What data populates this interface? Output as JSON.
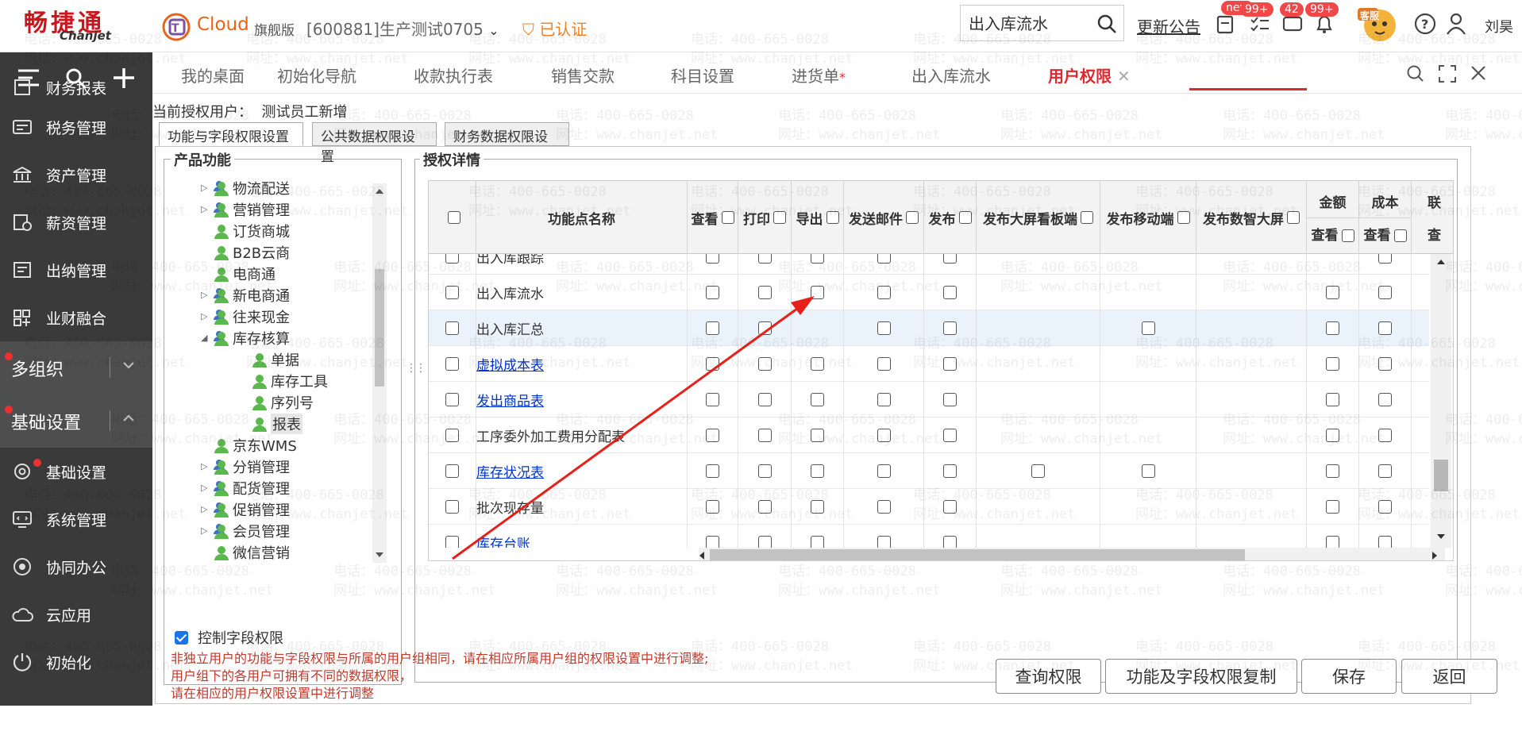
{
  "brand": {
    "logo_cn": "畅捷通",
    "logo_en": "Chanjet",
    "cloud": "Cloud",
    "edition": "旗舰版"
  },
  "header": {
    "company": "[600881]生产测试0705",
    "verified": "已认证",
    "search_value": "出入库流水",
    "notice": "更新公告",
    "badges": [
      "new",
      "99+",
      "42",
      "99+"
    ],
    "service": "客服",
    "username": "刘昊"
  },
  "sidebar": {
    "items_top": [
      {
        "label": "财务报表",
        "icon": "report-icon"
      },
      {
        "label": "税务管理",
        "icon": "tax-icon"
      },
      {
        "label": "资产管理",
        "icon": "bank-icon"
      },
      {
        "label": "薪资管理",
        "icon": "salary-icon"
      },
      {
        "label": "出纳管理",
        "icon": "cashier-icon"
      },
      {
        "label": "业财融合",
        "icon": "grid-icon"
      }
    ],
    "groups": [
      {
        "label": "多组织"
      },
      {
        "label": "基础设置"
      }
    ],
    "items_bottom": [
      {
        "label": "基础设置",
        "icon": "settings-icon"
      },
      {
        "label": "系统管理",
        "icon": "system-icon"
      },
      {
        "label": "协同办公",
        "icon": "collab-icon"
      },
      {
        "label": "云应用",
        "icon": "cloud-icon"
      },
      {
        "label": "初始化",
        "icon": "init-icon"
      }
    ]
  },
  "tabs": [
    {
      "label": "我的桌面"
    },
    {
      "label": "初始化导航"
    },
    {
      "label": "收款执行表"
    },
    {
      "label": "销售交款"
    },
    {
      "label": "科目设置"
    },
    {
      "label": "进货单"
    },
    {
      "label": "出入库流水"
    },
    {
      "label": "用户权限"
    }
  ],
  "tab_star": "*",
  "content": {
    "user_label": "当前授权用户：",
    "user_name": "测试员工新增",
    "subtabs": [
      "功能与字段权限设置",
      "公共数据权限设置",
      "财务数据权限设置"
    ],
    "tree_title": "产品功能",
    "tree": [
      {
        "label": "物流配送",
        "arrow": "▷",
        "indent": 0
      },
      {
        "label": "营销管理",
        "arrow": "▷",
        "indent": 0
      },
      {
        "label": "订货商城",
        "arrow": "",
        "indent": 0
      },
      {
        "label": "B2B云商",
        "arrow": "",
        "indent": 0
      },
      {
        "label": "电商通",
        "arrow": "",
        "indent": 0
      },
      {
        "label": "新电商通",
        "arrow": "▷",
        "indent": 0
      },
      {
        "label": "往来现金",
        "arrow": "▷",
        "indent": 0
      },
      {
        "label": "库存核算",
        "arrow": "◢",
        "indent": 0
      },
      {
        "label": "单据",
        "arrow": "",
        "indent": 1
      },
      {
        "label": "库存工具",
        "arrow": "",
        "indent": 1
      },
      {
        "label": "序列号",
        "arrow": "",
        "indent": 1
      },
      {
        "label": "报表",
        "arrow": "",
        "indent": 1
      },
      {
        "label": "京东WMS",
        "arrow": "",
        "indent": 0
      },
      {
        "label": "分销管理",
        "arrow": "▷",
        "indent": 0
      },
      {
        "label": "配货管理",
        "arrow": "▷",
        "indent": 0
      },
      {
        "label": "促销管理",
        "arrow": "▷",
        "indent": 0
      },
      {
        "label": "会员管理",
        "arrow": "▷",
        "indent": 0
      },
      {
        "label": "微信营销",
        "arrow": "",
        "indent": 0
      }
    ],
    "auth_title": "授权详情",
    "columns": [
      {
        "label": "功能点名称"
      },
      {
        "label": "查看"
      },
      {
        "label": "打印"
      },
      {
        "label": "导出"
      },
      {
        "label": "发送邮件"
      },
      {
        "label": "发布"
      },
      {
        "label": "发布大屏看板端"
      },
      {
        "label": "发布移动端"
      },
      {
        "label": "发布数智大屏"
      }
    ],
    "group_columns": [
      {
        "label": "金额",
        "sub": "查看"
      },
      {
        "label": "成本",
        "sub": "查看"
      },
      {
        "label": "联",
        "sub": "查"
      }
    ],
    "rows": [
      {
        "name": "出入库跟踪",
        "link": false,
        "fields": [
          1,
          1,
          1,
          1,
          1,
          0,
          0,
          0,
          0,
          1
        ]
      },
      {
        "name": "出入库流水",
        "link": false,
        "fields": [
          1,
          1,
          1,
          1,
          1,
          0,
          0,
          0,
          1,
          1
        ]
      },
      {
        "name": "出入库汇总",
        "link": false,
        "fields": [
          1,
          1,
          0,
          1,
          1,
          0,
          1,
          0,
          1,
          1
        ]
      },
      {
        "name": "虚拟成本表",
        "link": true,
        "fields": [
          1,
          1,
          1,
          1,
          1,
          0,
          0,
          0,
          1,
          1
        ]
      },
      {
        "name": "发出商品表",
        "link": true,
        "fields": [
          1,
          1,
          1,
          1,
          1,
          0,
          0,
          0,
          1,
          1
        ]
      },
      {
        "name": "工序委外加工费用分配表",
        "link": false,
        "fields": [
          1,
          1,
          1,
          1,
          1,
          0,
          0,
          0,
          1,
          1
        ]
      },
      {
        "name": "库存状况表",
        "link": true,
        "fields": [
          1,
          1,
          1,
          1,
          1,
          1,
          1,
          0,
          1,
          1
        ]
      },
      {
        "name": "批次现存量",
        "link": false,
        "fields": [
          1,
          1,
          1,
          1,
          1,
          0,
          0,
          0,
          1,
          1
        ]
      },
      {
        "name": "库存台账",
        "link": true,
        "fields": [
          1,
          1,
          1,
          1,
          1,
          0,
          0,
          0,
          1,
          1
        ]
      }
    ],
    "selected_row": 2,
    "control_field_label": "控制字段权限",
    "notes": [
      "非独立用户的功能与字段权限与所属的用户组相同，请在相应所属用户组的权限设置中进行调整;",
      "用户组下的各用户可拥有不同的数据权限，",
      "请在相应的用户权限设置中进行调整"
    ],
    "buttons": {
      "query": "查询权限",
      "copy": "功能及字段权限复制",
      "save": "保存",
      "back": "返回"
    }
  },
  "watermark": {
    "phone": "电话：400-665-0028",
    "site": "网址：www.chanjet.net"
  },
  "colors": {
    "accent": "#e0272e",
    "sidebar": "#3a3a3a",
    "link": "#0033cc",
    "warn": "#c0392b",
    "verified": "#ef8224"
  }
}
